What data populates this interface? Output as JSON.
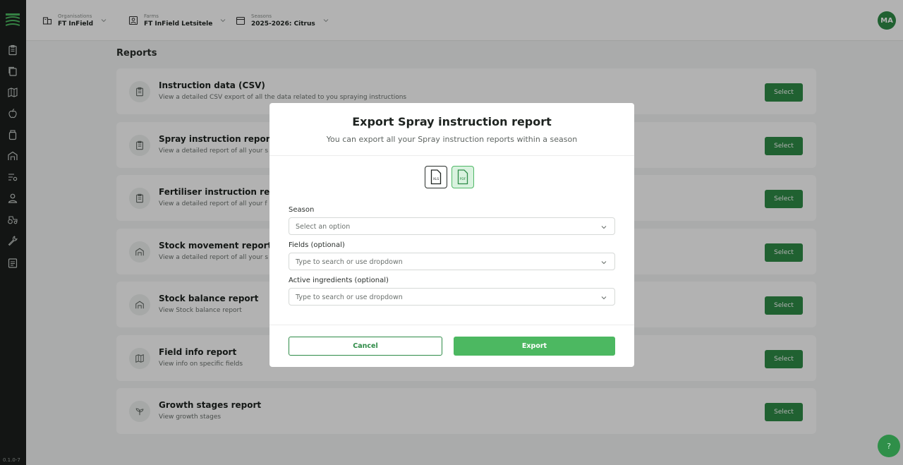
{
  "version": "0.1.0-7",
  "header": {
    "organisation": {
      "label": "Organisations",
      "value": "FT InField"
    },
    "farm": {
      "label": "Farms",
      "value": "FT InField Letsitele"
    },
    "season": {
      "label": "Seasons",
      "value": "2025-2026: Citrus"
    },
    "avatar_initials": "MA"
  },
  "sidebar": {
    "icons": [
      "logo-icon",
      "clipboard-icon",
      "copy-icon",
      "map-icon",
      "apple-icon",
      "jar-icon",
      "barn-icon",
      "list-filter-icon",
      "user-icon",
      "tractor-icon",
      "wrench-icon",
      "document-icon"
    ]
  },
  "main": {
    "title": "Reports",
    "select_label": "Select",
    "reports": [
      {
        "title": "Instruction data (CSV)",
        "description": "View a detailed CSV export of all the data related to you spraying instructions",
        "icon": "clipboard-icon"
      },
      {
        "title": "Spray instruction report",
        "description": "View a detailed report of all your s",
        "icon": "clipboard-icon"
      },
      {
        "title": "Fertiliser instruction report",
        "description": "View a detailed report of all your f",
        "icon": "clipboard-icon"
      },
      {
        "title": "Stock movement report",
        "description": "View a detailed report of all your s",
        "icon": "barn-icon"
      },
      {
        "title": "Stock balance report",
        "description": "View Stock balance report",
        "icon": "barn-icon"
      },
      {
        "title": "Field info report",
        "description": "View info on specific fields",
        "icon": "map-icon"
      },
      {
        "title": "Growth stages report",
        "description": "View growth stages",
        "icon": "sprout-icon"
      }
    ]
  },
  "modal": {
    "title": "Export Spray instruction report",
    "subtitle": "You can export all your Spray instruction reports within a season",
    "formats": [
      {
        "label": "XLS",
        "selected": false
      },
      {
        "label": "PDF",
        "selected": true
      }
    ],
    "fields": [
      {
        "label": "Season",
        "placeholder": "Select an option"
      },
      {
        "label": "Fields (optional)",
        "placeholder": "Type to search or use dropdown"
      },
      {
        "label": "Active ingredients (optional)",
        "placeholder": "Type to search or use dropdown"
      }
    ],
    "cancel_label": "Cancel",
    "export_label": "Export"
  },
  "help_label": "?",
  "colors": {
    "brand": "#2e8b47",
    "brand_light": "#4cb861",
    "sidebar": "#1c1f1e"
  }
}
